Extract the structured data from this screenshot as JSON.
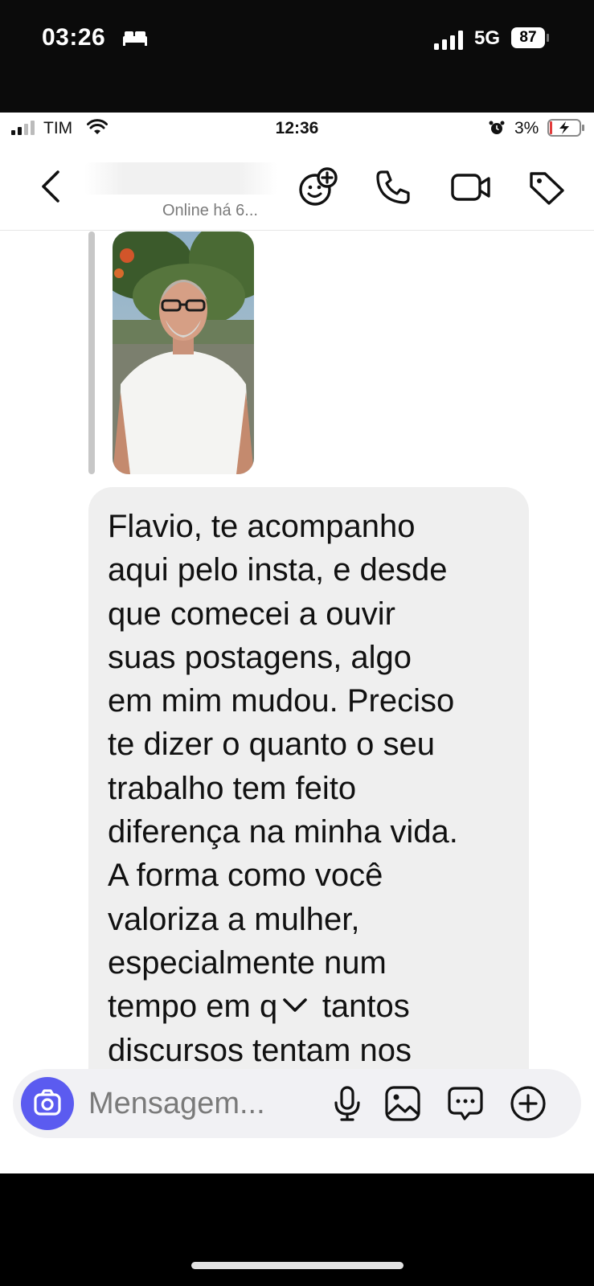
{
  "outer_status": {
    "time": "03:26",
    "network": "5G",
    "battery": "87",
    "icons": [
      "bed-icon",
      "cellular-signal-icon",
      "battery-icon"
    ]
  },
  "inner_status": {
    "carrier": "TIM",
    "time": "12:36",
    "battery_percent": "3%",
    "icons": [
      "cellular-signal-icon",
      "wifi-icon",
      "alarm-icon",
      "battery-charging-icon"
    ]
  },
  "header": {
    "status": "Online há 6...",
    "icons": [
      "back-chevron-icon",
      "sticker-plus-icon",
      "phone-icon",
      "video-camera-icon",
      "tag-icon"
    ]
  },
  "message": {
    "text": "Flavio, te acompanho\naqui pelo insta, e desde\nque comecei a ouvir\nsuas postagens, algo\nem mim mudou. Preciso\nte dizer o quanto o seu\ntrabalho tem feito\ndiferença na minha vida.\nA forma como você\nvaloriza a mulher,\nespecialmente num\ntempo em que tantos\ndiscursos tentam nos"
  },
  "composer": {
    "placeholder": "Mensagem...",
    "icons": [
      "camera-icon",
      "microphone-icon",
      "image-icon",
      "sticker-icon",
      "plus-circle-icon"
    ]
  },
  "colors": {
    "accent": "#5b5bf0",
    "bubble": "#efefef"
  }
}
